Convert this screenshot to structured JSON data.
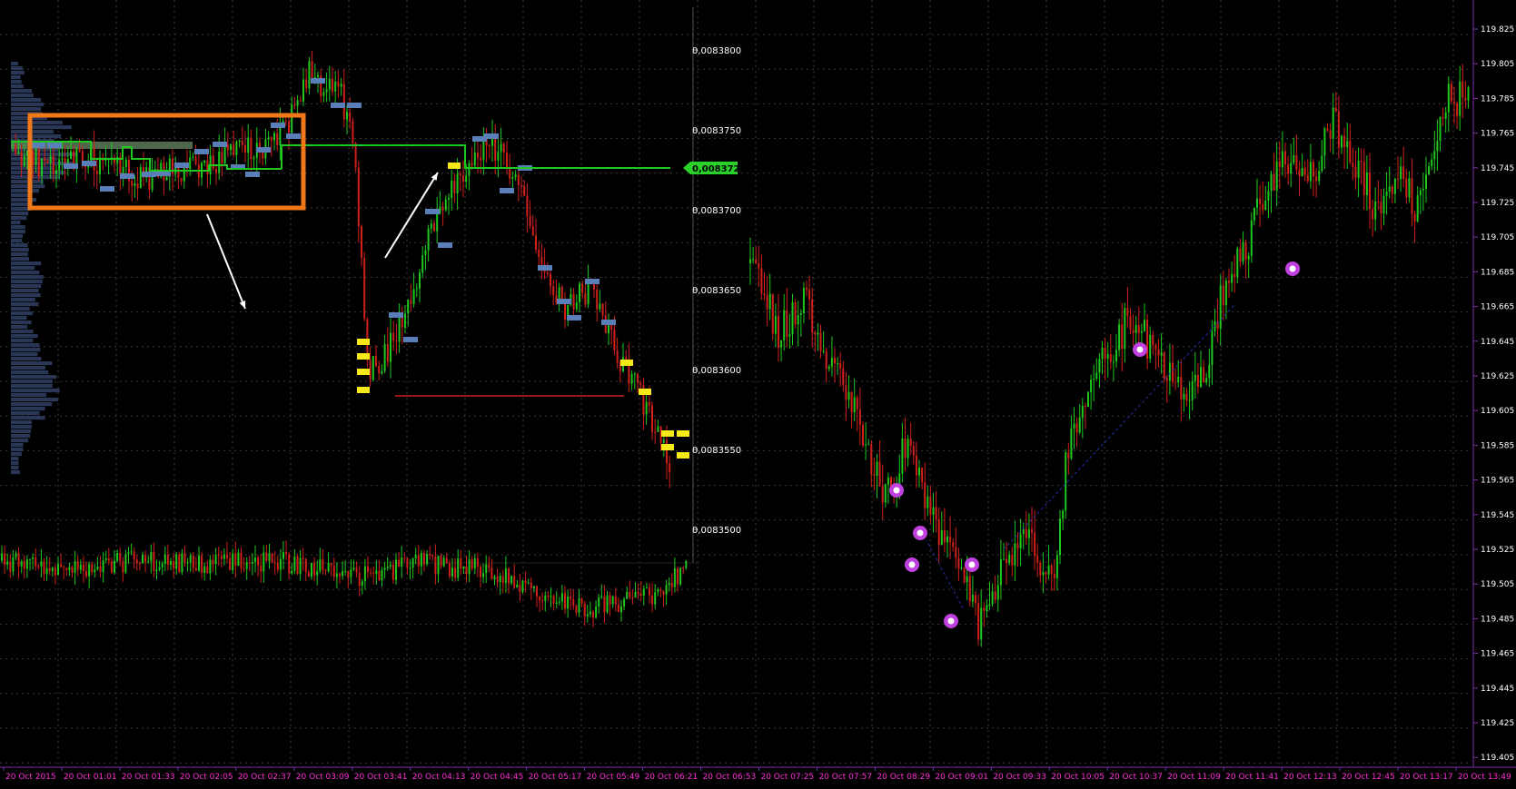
{
  "colors": {
    "background": "#000000",
    "grid": "#3a3a3a",
    "bull": "#1ec81e",
    "bear": "#d0201a",
    "axis_text": "#ffffff",
    "time_text": "#ff2fd6",
    "poc_line": "#1ec81e",
    "poc_tag": "#2bd12b",
    "highlight_box": "#f07818",
    "profile_fill": "#2a3656",
    "level_marker": "#5a7fb8",
    "yellow_marker": "#f7e81a",
    "support_line": "#d0201a",
    "arrow": "#ffffff",
    "signal_marker": "#c040e0"
  },
  "left_panel": {
    "price_axis": [
      "0,0083800",
      "0,0083750",
      "0,0083700",
      "0,0083650",
      "0,0083600",
      "0,0083550",
      "0,0083500"
    ],
    "current_price_tag": "0,0083725"
  },
  "right_panel": {
    "price_axis": [
      "119.825",
      "119.805",
      "119.785",
      "119.765",
      "119.745",
      "119.725",
      "119.705",
      "119.685",
      "119.665",
      "119.645",
      "119.625",
      "119.605",
      "119.585",
      "119.565",
      "119.545",
      "119.525",
      "119.505",
      "119.485",
      "119.465",
      "119.445",
      "119.425",
      "119.405"
    ]
  },
  "time_axis": [
    "20 Oct 2015",
    "20 Oct 01:01",
    "20 Oct 01:33",
    "20 Oct 02:05",
    "20 Oct 02:37",
    "20 Oct 03:09",
    "20 Oct 03:41",
    "20 Oct 04:13",
    "20 Oct 04:45",
    "20 Oct 05:17",
    "20 Oct 05:49",
    "20 Oct 06:21",
    "20 Oct 06:53",
    "20 Oct 07:25",
    "20 Oct 07:57",
    "20 Oct 08:29",
    "20 Oct 09:01",
    "20 Oct 09:33",
    "20 Oct 10:05",
    "20 Oct 10:37",
    "20 Oct 11:09",
    "20 Oct 11:41",
    "20 Oct 12:13",
    "20 Oct 12:45",
    "20 Oct 13:17",
    "20 Oct 13:49"
  ],
  "chart_data": [
    {
      "type": "line",
      "title": "",
      "xlabel": "",
      "ylabel": "",
      "ylim": [
        0.008348,
        0.008382
      ],
      "grid": true,
      "x": [
        "20 Oct 2015",
        "20 Oct 01:01",
        "20 Oct 01:33",
        "20 Oct 02:05",
        "20 Oct 02:37",
        "20 Oct 03:09",
        "20 Oct 03:41",
        "20 Oct 04:13",
        "20 Oct 04:45",
        "20 Oct 05:17",
        "20 Oct 05:49",
        "20 Oct 06:21",
        "20 Oct 06:53"
      ],
      "series": [
        {
          "values": [
            0.008374,
            0.0083725,
            0.008372,
            0.008373,
            0.0083735,
            0.008378,
            0.008359,
            0.008368,
            0.008374,
            0.008372,
            0.008365,
            0.00836,
            0.008354
          ]
        }
      ],
      "annotations": {
        "poc_level": 0.0083725,
        "support_level": 0.008358
      }
    },
    {
      "type": "line",
      "title": "",
      "xlabel": "",
      "ylabel": "",
      "ylim": [
        0.008348,
        0.008382
      ],
      "grid": true,
      "x": [
        "20 Oct 2015",
        "20 Oct 01:01",
        "20 Oct 01:33",
        "20 Oct 02:05",
        "20 Oct 02:37",
        "20 Oct 03:09",
        "20 Oct 03:41",
        "20 Oct 04:13",
        "20 Oct 04:45",
        "20 Oct 05:17",
        "20 Oct 05:49",
        "20 Oct 06:21",
        "20 Oct 06:53"
      ],
      "series": [
        {
          "values": [
            0.008374,
            0.0083725,
            0.008372,
            0.008373,
            0.0083735,
            0.008378,
            0.008359,
            0.008368,
            0.008374,
            0.008372,
            0.008365,
            0.00836,
            0.008354
          ]
        }
      ]
    },
    {
      "type": "line",
      "title": "",
      "xlabel": "",
      "ylabel": "",
      "ylim": [
        119.4,
        119.83
      ],
      "grid": true,
      "x": [
        "20 Oct 07:25",
        "20 Oct 07:57",
        "20 Oct 08:29",
        "20 Oct 09:01",
        "20 Oct 09:33",
        "20 Oct 10:05",
        "20 Oct 10:37",
        "20 Oct 11:09",
        "20 Oct 11:41",
        "20 Oct 12:13",
        "20 Oct 12:45",
        "20 Oct 13:17",
        "20 Oct 13:49"
      ],
      "series": [
        {
          "values": [
            119.7,
            119.64,
            119.56,
            119.49,
            119.53,
            119.61,
            119.64,
            119.62,
            119.66,
            119.72,
            119.75,
            119.74,
            119.79
          ]
        }
      ]
    }
  ]
}
